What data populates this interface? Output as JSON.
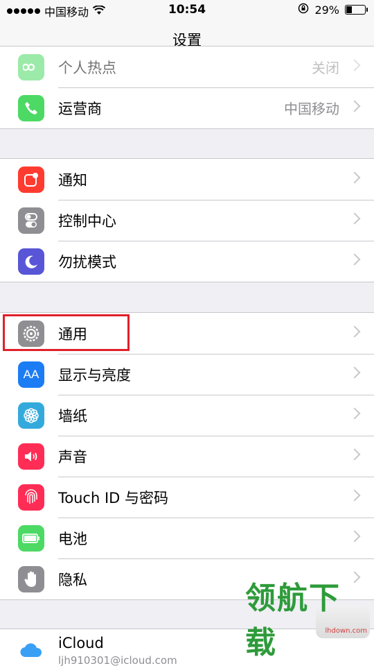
{
  "status": {
    "carrier": "中国移动",
    "time": "10:54",
    "battery": "29%",
    "battery_level": 0.29
  },
  "nav": {
    "title": "设置"
  },
  "group1": [
    {
      "label": "个人热点",
      "value": "关闭",
      "icon": "hotspot-icon",
      "color": "#4cd964"
    },
    {
      "label": "运营商",
      "value": "中国移动",
      "icon": "phone-icon",
      "color": "#4cd964"
    }
  ],
  "group2": [
    {
      "label": "通知",
      "icon": "notifications-icon",
      "color": "#ff3b30"
    },
    {
      "label": "控制中心",
      "icon": "control-center-icon",
      "color": "#8e8e93"
    },
    {
      "label": "勿扰模式",
      "icon": "moon-icon",
      "color": "#5856d6"
    }
  ],
  "group3": [
    {
      "label": "通用",
      "icon": "gear-icon",
      "color": "#8e8e93"
    },
    {
      "label": "显示与亮度",
      "icon": "brightness-icon",
      "color": "#1c7cf4",
      "glyph": "AA"
    },
    {
      "label": "墙纸",
      "icon": "wallpaper-icon",
      "color": "#34aadc"
    },
    {
      "label": "声音",
      "icon": "speaker-icon",
      "color": "#ff2d55"
    },
    {
      "label": "Touch ID 与密码",
      "icon": "fingerprint-icon",
      "color": "#ff2d55"
    },
    {
      "label": "电池",
      "icon": "battery-icon",
      "color": "#4cd964"
    },
    {
      "label": "隐私",
      "icon": "hand-icon",
      "color": "#8e8e93"
    }
  ],
  "icloud": {
    "label": "iCloud",
    "email": "ljh910301@icloud.com"
  },
  "watermark": {
    "url": "lhdown.com",
    "text": "领航下载"
  }
}
